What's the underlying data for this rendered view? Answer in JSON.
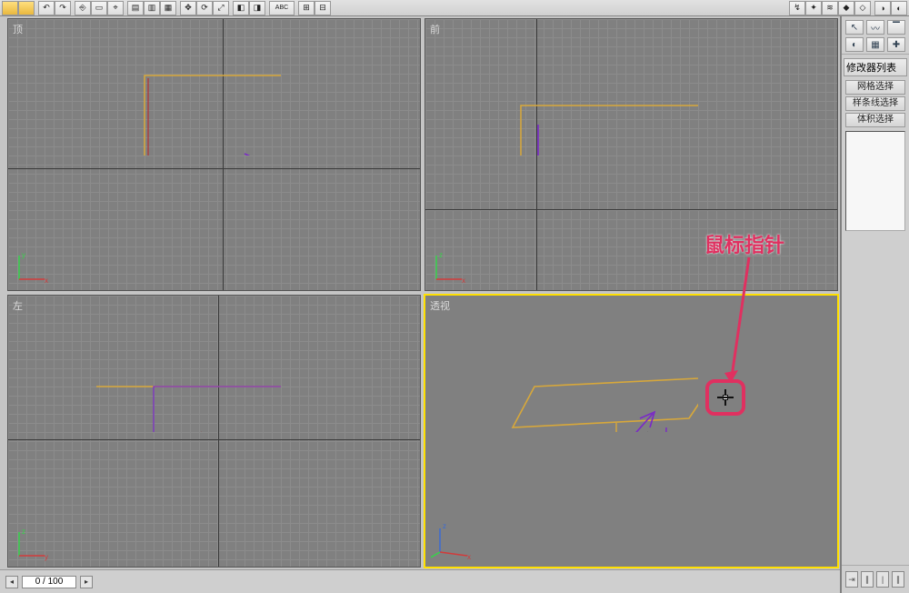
{
  "toolbar": {
    "icons": [
      "↶",
      "↷",
      "⎙",
      "✚",
      "◌",
      "⇱",
      "⇲",
      "⌖",
      "◧",
      "◨",
      "▢",
      "▣",
      "⊞",
      "⊟",
      "≡",
      "ABC",
      "⟲",
      "⟳",
      "↯",
      "✦",
      "≋",
      "◆",
      "◇",
      "▲",
      "△",
      "◈"
    ]
  },
  "viewports": {
    "top": {
      "label": "顶",
      "axis1": "y",
      "axis2": "x"
    },
    "front": {
      "label": "前",
      "axis1": "z",
      "axis2": "x"
    },
    "left": {
      "label": "左",
      "axis1": "z",
      "axis2": "y"
    },
    "persp": {
      "label": "透视",
      "axis1": "z",
      "axis2": "x"
    }
  },
  "panel": {
    "modifier_list": "修改器列表",
    "btn_mesh_select": "网格选择",
    "btn_spline_select": "样条线选择",
    "btn_vol_select": "体积选择"
  },
  "callout": {
    "text": "鼠标指针"
  },
  "bottom": {
    "frame_readout": "0 / 100"
  },
  "colors": {
    "accent": "#e03060",
    "active": "#ffe000"
  }
}
